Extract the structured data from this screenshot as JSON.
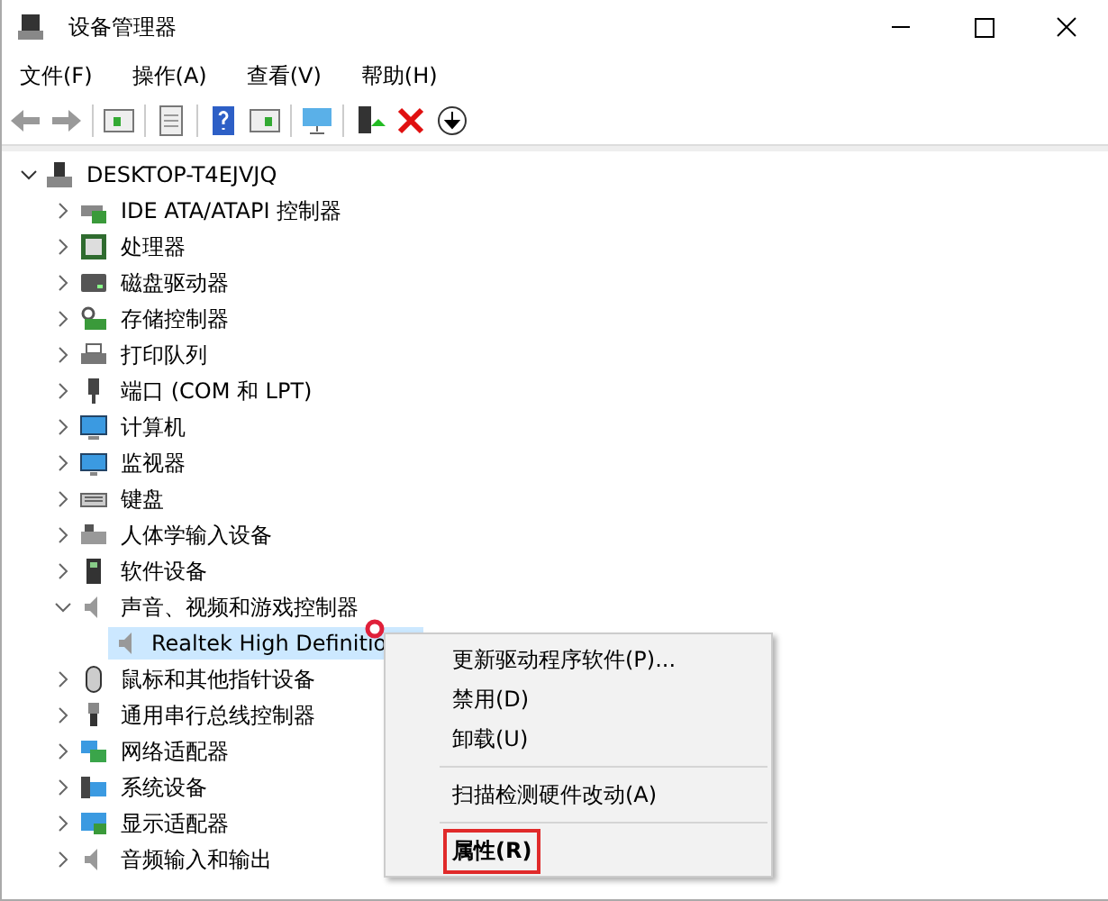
{
  "window": {
    "title": "设备管理器"
  },
  "menu_bar": [
    "文件(F)",
    "操作(A)",
    "查看(V)",
    "帮助(H)"
  ],
  "tree": {
    "label": "DESKTOP-T4EJVJQ",
    "expanded": true,
    "selected": false,
    "children": [
      {
        "label": "IDE ATA/ATAPI 控制器",
        "expanded": false,
        "selected": false
      },
      {
        "label": "处理器",
        "expanded": false,
        "selected": false
      },
      {
        "label": "磁盘驱动器",
        "expanded": false,
        "selected": false
      },
      {
        "label": "存储控制器",
        "expanded": false,
        "selected": false
      },
      {
        "label": "打印队列",
        "expanded": false,
        "selected": false
      },
      {
        "label": "端口 (COM 和 LPT)",
        "expanded": false,
        "selected": false
      },
      {
        "label": "计算机",
        "expanded": false,
        "selected": false
      },
      {
        "label": "监视器",
        "expanded": false,
        "selected": false
      },
      {
        "label": "键盘",
        "expanded": false,
        "selected": false
      },
      {
        "label": "人体学输入设备",
        "expanded": false,
        "selected": false
      },
      {
        "label": "软件设备",
        "expanded": false,
        "selected": false
      },
      {
        "label": "声音、视频和游戏控制器",
        "expanded": true,
        "selected": false,
        "children": [
          {
            "label": "Realtek High Definitio",
            "selected": true
          }
        ]
      },
      {
        "label": "鼠标和其他指针设备",
        "expanded": false,
        "selected": false
      },
      {
        "label": "通用串行总线控制器",
        "expanded": false,
        "selected": false
      },
      {
        "label": "网络适配器",
        "expanded": false,
        "selected": false
      },
      {
        "label": "系统设备",
        "expanded": false,
        "selected": false
      },
      {
        "label": "显示适配器",
        "expanded": false,
        "selected": false
      },
      {
        "label": "音频输入和输出",
        "expanded": false,
        "selected": false
      }
    ]
  },
  "context_menu": [
    {
      "kind": "item",
      "label": "更新驱动程序软件(P)...",
      "bold": false,
      "highlighted": false
    },
    {
      "kind": "item",
      "label": "禁用(D)",
      "bold": false,
      "highlighted": false
    },
    {
      "kind": "item",
      "label": "卸载(U)",
      "bold": false,
      "highlighted": false
    },
    {
      "kind": "separator"
    },
    {
      "kind": "item",
      "label": "扫描检测硬件改动(A)",
      "bold": false,
      "highlighted": false
    },
    {
      "kind": "separator"
    },
    {
      "kind": "item",
      "label": "属性(R)",
      "bold": true,
      "highlighted": true
    }
  ]
}
